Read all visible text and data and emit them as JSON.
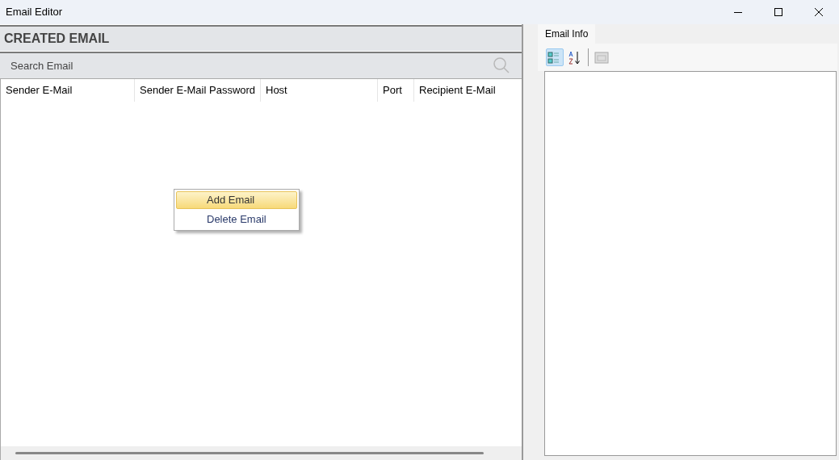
{
  "window": {
    "title": "Email Editor"
  },
  "panel": {
    "title": "CREATED EMAIL"
  },
  "search": {
    "placeholder": "Search Email"
  },
  "table": {
    "columns": [
      {
        "label": "Sender E-Mail"
      },
      {
        "label": "Sender E-Mail Password"
      },
      {
        "label": "Host"
      },
      {
        "label": "Port"
      },
      {
        "label": "Recipient E-Mail"
      }
    ]
  },
  "context_menu": {
    "items": [
      {
        "label": "Add Email",
        "selected": true
      },
      {
        "label": "Delete Email",
        "selected": false
      }
    ]
  },
  "properties": {
    "tabs": [
      {
        "label": "Email Info",
        "selected": true
      }
    ],
    "toolbar": [
      {
        "kind": "categorized",
        "selected": true
      },
      {
        "kind": "alphabetical",
        "selected": false
      },
      {
        "kind": "pages",
        "selected": false
      }
    ]
  }
}
